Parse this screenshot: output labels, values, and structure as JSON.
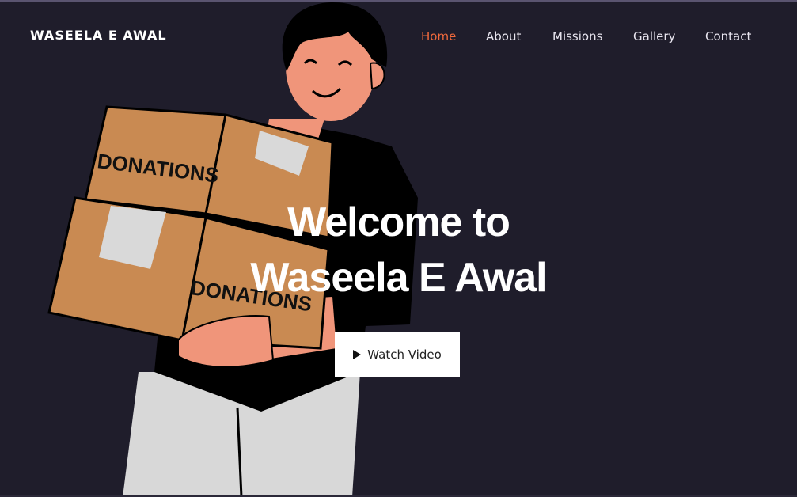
{
  "brand": {
    "name": "WASEELA E AWAL"
  },
  "nav": {
    "items": [
      {
        "label": "Home",
        "active": true
      },
      {
        "label": "About",
        "active": false
      },
      {
        "label": "Missions",
        "active": false
      },
      {
        "label": "Gallery",
        "active": false
      },
      {
        "label": "Contact",
        "active": false
      }
    ]
  },
  "hero": {
    "title_line1": "Welcome to",
    "title_line2": "Waseela E Awal",
    "button_label": "Watch Video",
    "box_label_top": "DONATIONS",
    "box_label_bottom": "DONATIONS"
  },
  "colors": {
    "background": "#1f1d2b",
    "accent": "#f26a3d",
    "nav_text": "#e9e6f0",
    "box": "#c98a52",
    "skin": "#f0957a",
    "shirt": "#000000",
    "pants": "#d8d8d8"
  },
  "icons": {
    "play": "play-icon"
  }
}
